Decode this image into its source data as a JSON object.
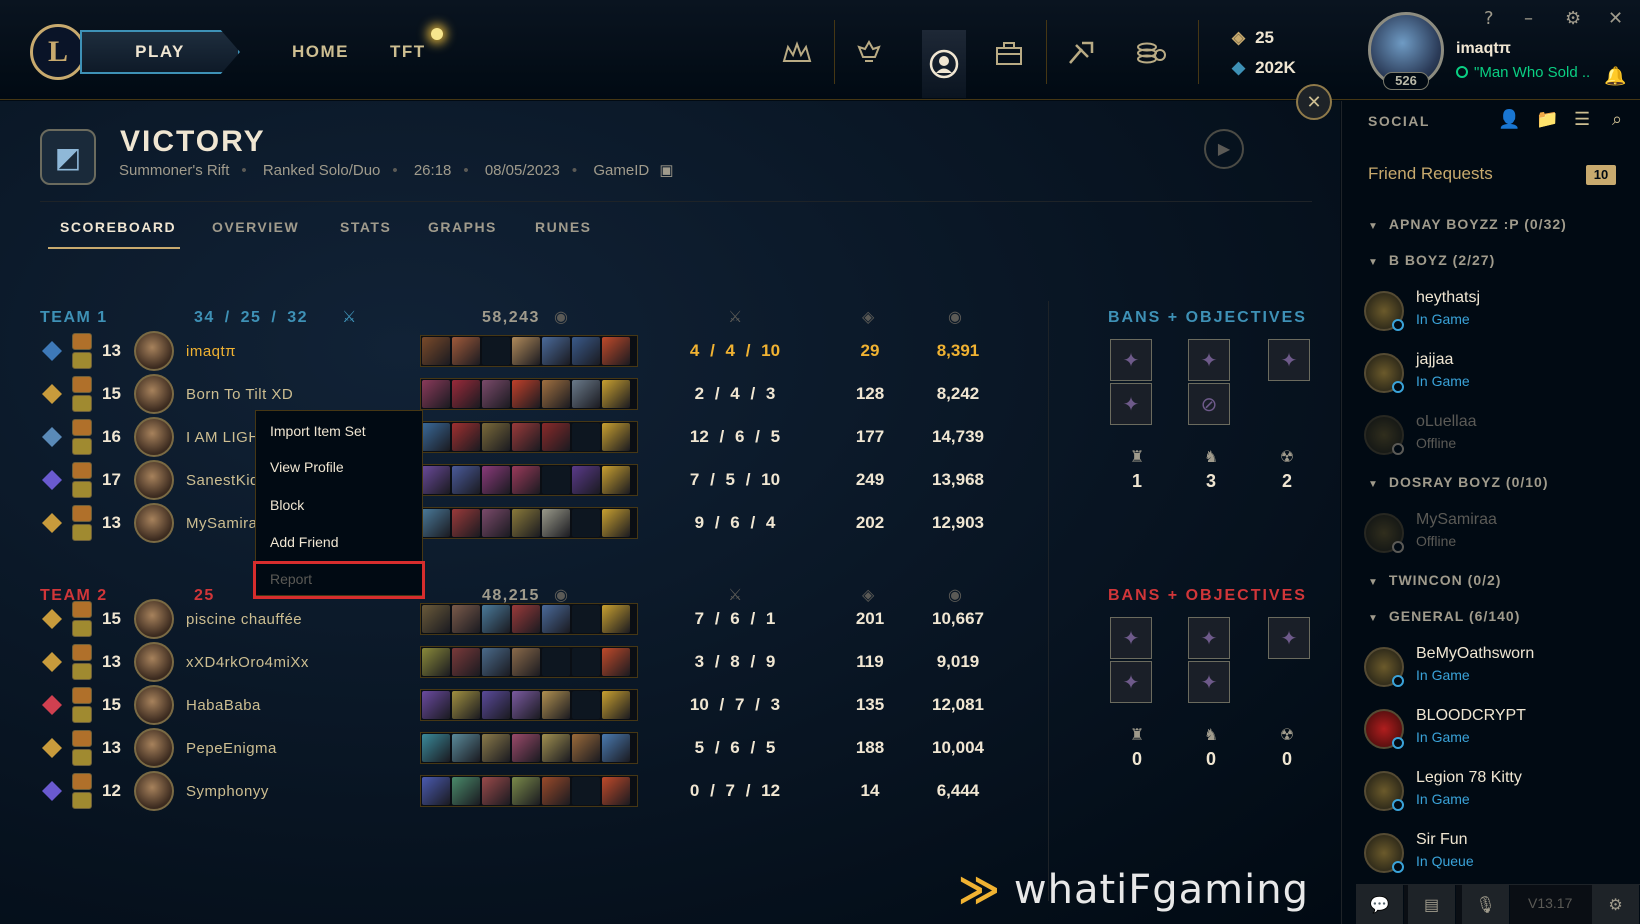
{
  "nav": {
    "play": "PLAY",
    "home": "HOME",
    "tft": "TFT"
  },
  "currency": {
    "rp": "25",
    "be": "202K"
  },
  "summoner": {
    "name": "imaqtπ",
    "level": "526",
    "status": "\"Man Who Sold .."
  },
  "window": {
    "help": "?",
    "minimize": "–",
    "settings": "⚙",
    "close": "✕"
  },
  "match": {
    "result": "VICTORY",
    "map": "Summoner's Rift",
    "queue": "Ranked Solo/Duo",
    "duration": "26:18",
    "date": "08/05/2023",
    "gameid_label": "GameID"
  },
  "tabs": [
    "SCOREBOARD",
    "OVERVIEW",
    "STATS",
    "GRAPHS",
    "RUNES"
  ],
  "team1": {
    "label": "TEAM 1",
    "k": "34",
    "d": "25",
    "a": "32",
    "gold": "58,243",
    "players": [
      {
        "level": "13",
        "name": "imaqtπ",
        "kda": "4  /  4  / 10",
        "cs": "29",
        "gold": "8,391"
      },
      {
        "level": "15",
        "name": "Born To Tilt XD",
        "kda": "2  /  4  /  3",
        "cs": "128",
        "gold": "8,242"
      },
      {
        "level": "16",
        "name": "I AM LIGHTNING",
        "kda": "12  /  6  /  5",
        "cs": "177",
        "gold": "14,739"
      },
      {
        "level": "17",
        "name": "SanestKid",
        "kda": "7  /  5  / 10",
        "cs": "249",
        "gold": "13,968"
      },
      {
        "level": "13",
        "name": "MySamira",
        "kda": "9  /  6  /  4",
        "cs": "202",
        "gold": "12,903"
      }
    ],
    "bans_label": "BANS + OBJECTIVES",
    "towers": "1",
    "dragons": "3",
    "barons": "2"
  },
  "team2": {
    "label": "TEAM 2",
    "k": "25",
    "gold": "48,215",
    "players": [
      {
        "level": "15",
        "name": "piscine chauffée",
        "kda": "7  /  6  /  1",
        "cs": "201",
        "gold": "10,667"
      },
      {
        "level": "13",
        "name": "xXD4rkOro4miXx",
        "kda": "3  /  8  /  9",
        "cs": "119",
        "gold": "9,019"
      },
      {
        "level": "15",
        "name": "HabaBaba",
        "kda": "10  /  7  /  3",
        "cs": "135",
        "gold": "12,081"
      },
      {
        "level": "13",
        "name": "PepeEnigma",
        "kda": "5  /  6  /  5",
        "cs": "188",
        "gold": "10,004"
      },
      {
        "level": "12",
        "name": "Symphonyy",
        "kda": "0  /  7  / 12",
        "cs": "14",
        "gold": "6,444"
      }
    ],
    "bans_label": "BANS + OBJECTIVES",
    "towers": "0",
    "dragons": "0",
    "barons": "0"
  },
  "context_menu": [
    "Import Item Set",
    "View Profile",
    "Block",
    "Add Friend",
    "Report"
  ],
  "social": {
    "title": "SOCIAL",
    "friend_requests": "Friend Requests",
    "request_count": "10",
    "groups": [
      "APNAY BOYZZ :P (0/32)",
      "B BOYZ (2/27)",
      "DOSRAY BOYZ (0/10)",
      "TWINCON (0/2)",
      "GENERAL (6/140)"
    ],
    "friends": [
      {
        "name": "heythatsj",
        "status": "In Game"
      },
      {
        "name": "jajjaa",
        "status": "In Game"
      },
      {
        "name": "oLuellaa",
        "status": "Offline"
      },
      {
        "name": "MySamiraa",
        "status": "Offline"
      },
      {
        "name": "BeMyOathsworn",
        "status": "In Game"
      },
      {
        "name": "BLOODCRYPT",
        "status": "In Game"
      },
      {
        "name": "Legion 78 Kitty",
        "status": "In Game"
      },
      {
        "name": "Sir Fun",
        "status": "In Queue"
      }
    ],
    "version": "V13.17"
  },
  "watermark": "whatiFgaming",
  "colors": {
    "gold": "#c8aa6e",
    "team1": "#3e91b6",
    "team2": "#d13639",
    "highlight": "#f0b232",
    "ingame": "#3aa3d9",
    "online": "#0acf83"
  }
}
